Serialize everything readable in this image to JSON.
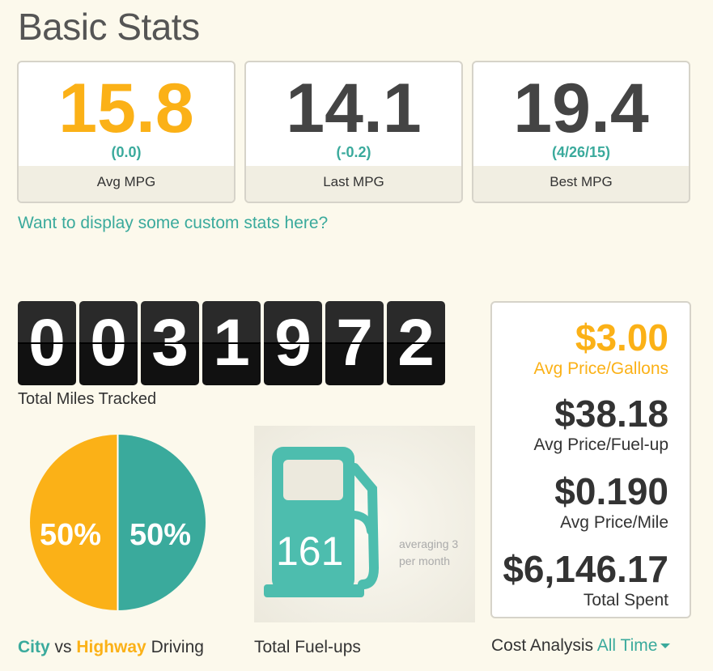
{
  "page": {
    "title": "Basic Stats"
  },
  "stats": [
    {
      "value": "15.8",
      "delta": "(0.0)",
      "label": "Avg MPG"
    },
    {
      "value": "14.1",
      "delta": "(-0.2)",
      "label": "Last MPG"
    },
    {
      "value": "19.4",
      "delta": "(4/26/15)",
      "label": "Best MPG"
    }
  ],
  "custom_stats_link": "Want to display some custom stats here?",
  "odometer": {
    "digits": [
      "0",
      "0",
      "3",
      "1",
      "9",
      "7",
      "2"
    ],
    "label": "Total Miles Tracked"
  },
  "driving": {
    "city_percent": "50%",
    "highway_percent": "50%",
    "caption_city": "City",
    "caption_vs": "vs",
    "caption_highway": "Highway",
    "caption_driving": "Driving",
    "city_share": 0.5,
    "highway_share": 0.5
  },
  "fuelups": {
    "count": "161",
    "averaging": "averaging 3 per month",
    "caption": "Total Fuel-ups",
    "icon": "fuel-pump-icon"
  },
  "cost": {
    "rows": [
      {
        "amount": "$3.00",
        "label": "Avg Price/Gallons"
      },
      {
        "amount": "$38.18",
        "label": "Avg Price/Fuel-up"
      },
      {
        "amount": "$0.190",
        "label": "Avg Price/Mile"
      },
      {
        "amount": "$6,146.17",
        "label": "Total Spent"
      }
    ],
    "caption": "Cost Analysis",
    "period": "All Time"
  },
  "colors": {
    "accent_orange": "#fbb117",
    "accent_teal": "#3aaa9c",
    "background": "#fcf9ec"
  }
}
